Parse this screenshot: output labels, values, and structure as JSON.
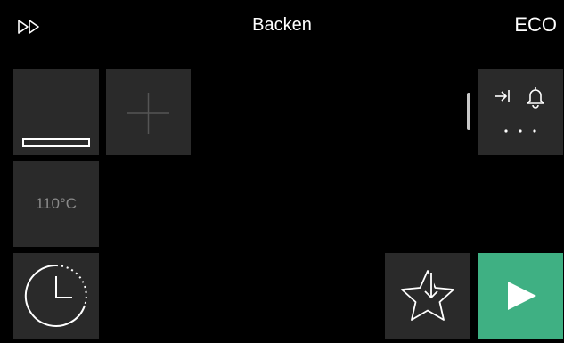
{
  "header": {
    "title": "Backen",
    "eco_label": "ECO",
    "fast_forward_icon": "fast-forward-icon"
  },
  "tiles": {
    "heat_mode_icon": "bottom-heat-icon",
    "add_icon": "plus-icon",
    "temperature": "110°C",
    "timer_icon": "clock-timer-icon",
    "favorite_icon": "star-download-icon",
    "start_icon": "play-icon",
    "alarm_icons": [
      "skip-to-end-icon",
      "bell-icon",
      "more-dots-icon"
    ]
  },
  "colors": {
    "background": "#000000",
    "tile": "#2a2a2a",
    "start_accent": "#3fb083",
    "muted_text": "#8a8a8a"
  }
}
